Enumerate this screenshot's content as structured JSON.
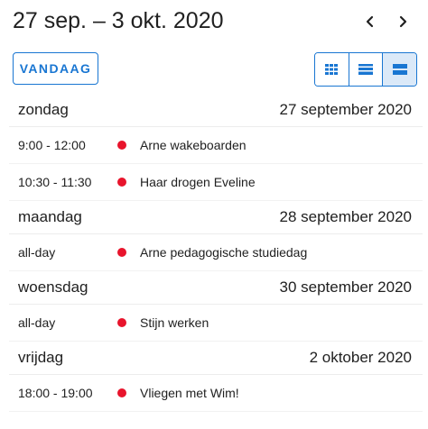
{
  "header": {
    "title": "27 sep. – 3 okt. 2020",
    "today_label": "VANDAAG"
  },
  "icons": {
    "prev": "chevron-left-icon",
    "next": "chevron-right-icon",
    "month_view": "grid-icon",
    "week_view": "week-rows-icon",
    "list_view": "list-icon"
  },
  "colors": {
    "accent": "#1976d2",
    "active_view_bg": "#dbe9f8",
    "event_dot": "#e8142c"
  },
  "days": [
    {
      "weekday": "zondag",
      "date": "27 september 2020",
      "events": [
        {
          "time": "9:00 - 12:00",
          "title": "Arne wakeboarden"
        },
        {
          "time": "10:30 - 11:30",
          "title": "Haar drogen Eveline"
        }
      ]
    },
    {
      "weekday": "maandag",
      "date": "28 september 2020",
      "events": [
        {
          "time": "all-day",
          "title": "Arne pedagogische studiedag"
        }
      ]
    },
    {
      "weekday": "woensdag",
      "date": "30 september 2020",
      "events": [
        {
          "time": "all-day",
          "title": "Stijn werken"
        }
      ]
    },
    {
      "weekday": "vrijdag",
      "date": "2 oktober 2020",
      "events": [
        {
          "time": "18:00 - 19:00",
          "title": "Vliegen met Wim!"
        }
      ]
    }
  ]
}
